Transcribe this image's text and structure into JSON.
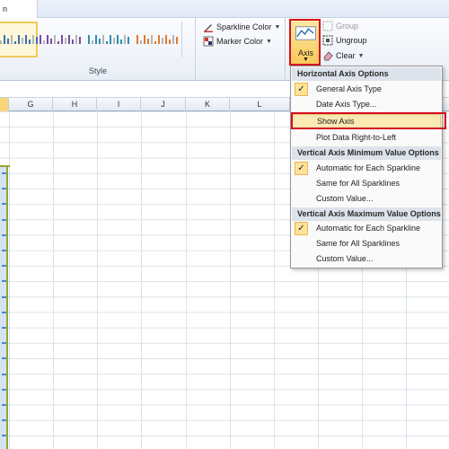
{
  "tabs": {
    "active": "n"
  },
  "ribbon": {
    "style_group_label": "Style",
    "sparkline_color": "Sparkline Color",
    "marker_color": "Marker Color",
    "axis_label": "Axis",
    "group_label": "Group",
    "ungroup_label": "Ungroup",
    "clear_label": "Clear",
    "swatch_colors": [
      "#3a6fb6",
      "#7a4f9c",
      "#2f8fb5",
      "#e07b2b"
    ]
  },
  "columns": [
    "G",
    "H",
    "I",
    "J",
    "K",
    "L"
  ],
  "menu": {
    "horizontal_header": "Horizontal Axis Options",
    "general_axis_type": "General Axis Type",
    "date_axis_type": "Date Axis Type...",
    "show_axis": "Show Axis",
    "plot_right_to_left": "Plot Data Right-to-Left",
    "vmin_header": "Vertical Axis Minimum Value Options",
    "vmin_auto": "Automatic for Each Sparkline",
    "vmin_same": "Same for All Sparklines",
    "vmin_custom": "Custom Value...",
    "vmax_header": "Vertical Axis Maximum Value Options",
    "vmax_auto": "Automatic for Each Sparkline",
    "vmax_same": "Same for All Sparklines",
    "vmax_custom": "Custom Value..."
  },
  "colors": {
    "highlight_red": "#d40e22",
    "selection_border": "#92a832",
    "hover": "#fde9b2"
  }
}
